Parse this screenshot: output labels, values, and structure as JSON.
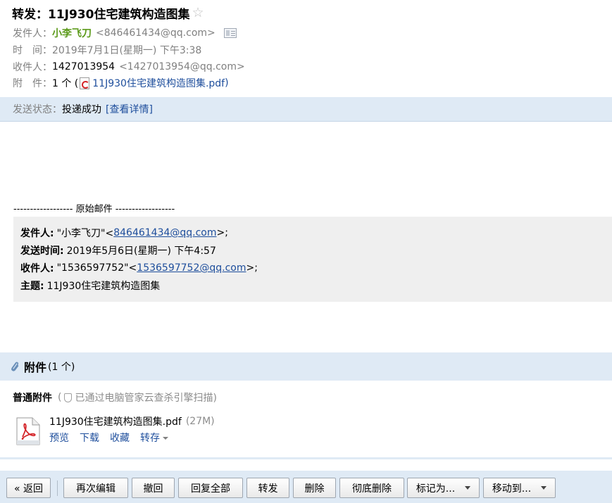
{
  "header": {
    "subject": "转发：11J930住宅建筑构造图集",
    "star": "☆",
    "from_label": "发件人：",
    "from_name": "小李飞刀",
    "from_addr": "<846461434@qq.com>",
    "time_label": "时　间：",
    "time_value": "2019年7月1日(星期一) 下午3:38",
    "to_label": "收件人：",
    "to_name": "1427013954",
    "to_addr": "<1427013954@qq.com>",
    "attach_label": "附　件：",
    "attach_count": "1 个 (",
    "attach_file": "11J930住宅建筑构造图集.pdf",
    "attach_close": ")"
  },
  "status": {
    "label": "发送状态：",
    "value": "投递成功",
    "detail_link": "[查看详情]"
  },
  "body": {
    "separator": "------------------ 原始邮件 ------------------",
    "quote": {
      "from_label": "发件人:",
      "from_name": "\"小李飞刀\"<",
      "from_email": "846461434@qq.com",
      "from_end": ">;",
      "sent_label": "发送时间:",
      "sent_value": "2019年5月6日(星期一) 下午4:57",
      "to_label": "收件人:",
      "to_name": "\"1536597752\"<",
      "to_email": "1536597752@qq.com",
      "to_end": ">;",
      "subject_label": "主题:",
      "subject_value": "11J930住宅建筑构造图集"
    }
  },
  "attachments": {
    "title": "附件",
    "count": "(1 个)",
    "kind_label": "普通附件",
    "scan_open": "(",
    "scan_text": "已通过电脑管家云查杀引擎扫描)",
    "file_name": "11J930住宅建筑构造图集.pdf",
    "file_size": "(27M)",
    "actions": {
      "preview": "预览",
      "download": "下载",
      "favorite": "收藏",
      "save_to": "转存"
    }
  },
  "toolbar": {
    "back": "« 返回",
    "reedit": "再次编辑",
    "recall": "撤回",
    "reply_all": "回复全部",
    "forward": "转发",
    "delete": "删除",
    "delete_perm": "彻底删除",
    "mark_as": "标记为...",
    "move_to": "移动到..."
  },
  "colors": {
    "sender_green": "#5d9b1c",
    "link_blue": "#1e4e9c",
    "bar_blue": "#dfeaf5",
    "quote_gray": "#efefef"
  }
}
